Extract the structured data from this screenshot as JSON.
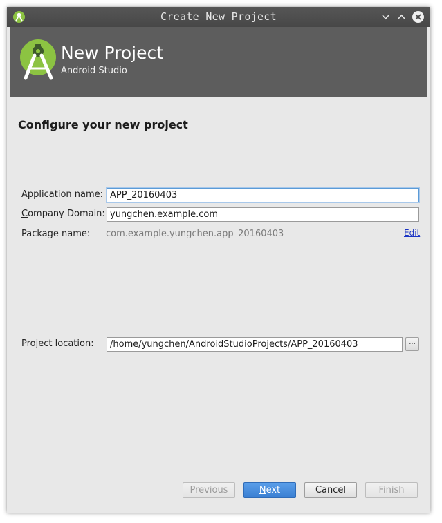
{
  "window": {
    "title": "Create New Project"
  },
  "titlebar": {
    "icons": [
      "android-studio-icon",
      "minimize-icon",
      "maximize-icon",
      "close-icon"
    ]
  },
  "banner": {
    "title": "New Project",
    "subtitle": "Android Studio"
  },
  "main": {
    "heading": "Configure your new project"
  },
  "form": {
    "application_name": {
      "label_mnemonic": "A",
      "label_rest": "pplication name:",
      "value": "APP_20160403"
    },
    "company_domain": {
      "label_mnemonic": "C",
      "label_rest": "ompany Domain:",
      "value": "yungchen.example.com"
    },
    "package_name": {
      "label": "Package name:",
      "value": "com.example.yungchen.app_20160403",
      "edit_link": "Edit"
    },
    "project_location": {
      "label": "Project location:",
      "value": "/home/yungchen/AndroidStudioProjects/APP_20160403",
      "browse_label": "..."
    }
  },
  "footer": {
    "previous_label": "Previous",
    "next_mnemonic": "N",
    "next_rest": "ext",
    "cancel_label": "Cancel",
    "finish_label": "Finish"
  },
  "colors": {
    "titlebar": "#4e4e4e",
    "banner": "#5d5d5d",
    "android_green": "#8cc342",
    "primary_button": "#4a8fde",
    "link": "#1a33c4"
  }
}
